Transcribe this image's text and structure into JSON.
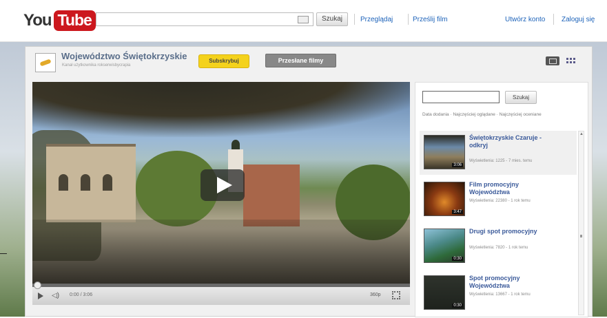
{
  "header": {
    "logo_you": "You",
    "logo_tube": "Tube",
    "search_placeholder": "",
    "search_button": "Szukaj",
    "links": [
      "Przeglądaj",
      "Prześlij film"
    ],
    "account_links": [
      "Utwórz konto",
      "Zaloguj się"
    ]
  },
  "channel": {
    "name": "Województwo Świętokrzyskie",
    "subtitle": "Kanał użytkownika rokserwisbycrapia",
    "subscribe_label": "Subskrybuj",
    "uploads_tab": "Przesłane filmy"
  },
  "player": {
    "time": "0:00 / 3:06",
    "quality": "360p",
    "progress_fraction": 0.0
  },
  "sidebar": {
    "search_button": "Szukaj",
    "sort_text": "Data dodania · Najczęściej oglądane · Najczęściej oceniane",
    "videos": [
      {
        "title": "Świętokrzyskie Czaruje - odkryj",
        "meta": "Wyświetlenia: 1225 - 7 mies. temu",
        "duration": "3:06"
      },
      {
        "title": "Film promocyjny Województwa",
        "meta": "Wyświetlenia: 22380 - 1 rok temu",
        "duration": "3:47"
      },
      {
        "title": "Drugi spot promocyjny",
        "meta": "Wyświetlenia: 7820 - 1 rok temu",
        "duration": "0:30"
      },
      {
        "title": "Spot promocyjny Województwa",
        "meta": "Wyświetlenia: 13667 - 1 rok temu",
        "duration": "0:30"
      }
    ]
  },
  "colors": {
    "brand_red": "#cc181e",
    "subscribe_yellow": "#f4d21c",
    "link_blue": "#3b5a9a"
  }
}
